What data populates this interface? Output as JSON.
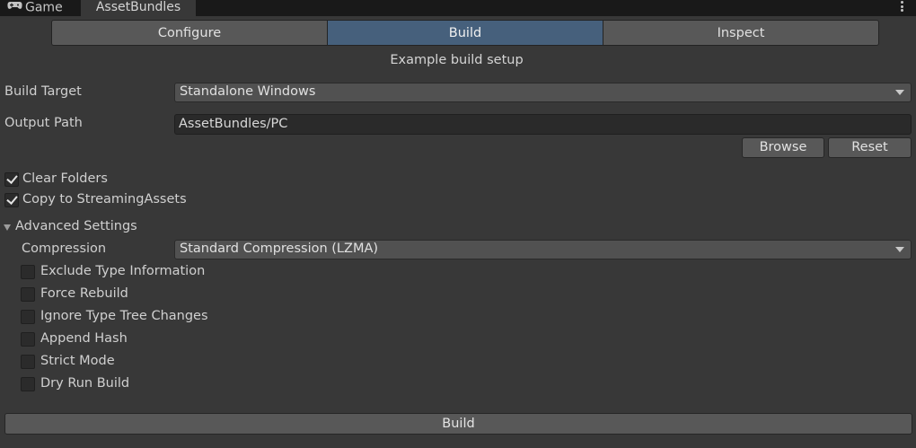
{
  "tabs": {
    "game": {
      "label": "Game",
      "icon": "gamepad-icon"
    },
    "assetbundles": {
      "label": "AssetBundles"
    }
  },
  "segments": {
    "configure": "Configure",
    "build": "Build",
    "inspect": "Inspect",
    "active": "build"
  },
  "subtitle": "Example build setup",
  "build_target": {
    "label": "Build Target",
    "value": "Standalone Windows"
  },
  "output_path": {
    "label": "Output Path",
    "value": "AssetBundles/PC"
  },
  "buttons": {
    "browse": "Browse",
    "reset": "Reset",
    "build": "Build"
  },
  "options": {
    "clear_folders": {
      "label": "Clear Folders",
      "checked": true
    },
    "copy_streaming": {
      "label": "Copy to StreamingAssets",
      "checked": true
    }
  },
  "advanced": {
    "title": "Advanced Settings",
    "expanded": true,
    "compression": {
      "label": "Compression",
      "value": "Standard Compression (LZMA)"
    },
    "flags": [
      {
        "label": "Exclude Type Information",
        "checked": false
      },
      {
        "label": "Force Rebuild",
        "checked": false
      },
      {
        "label": "Ignore Type Tree Changes",
        "checked": false
      },
      {
        "label": "Append Hash",
        "checked": false
      },
      {
        "label": "Strict Mode",
        "checked": false
      },
      {
        "label": "Dry Run Build",
        "checked": false
      }
    ]
  },
  "colors": {
    "background": "#383838",
    "tabbar": "#191919",
    "active_segment": "#46607c",
    "button": "#585858",
    "text": "#d2d2d2"
  }
}
